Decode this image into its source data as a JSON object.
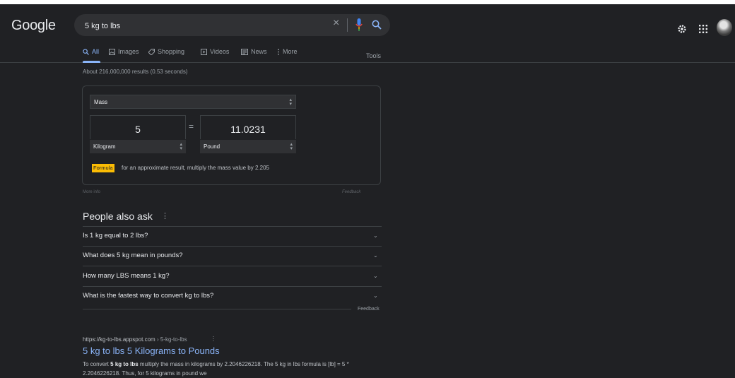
{
  "header": {
    "logo": "Google",
    "search_value": "5 kg to lbs",
    "icons": [
      "close-icon",
      "mic-icon",
      "search-icon",
      "gear-icon",
      "apps-icon",
      "avatar"
    ]
  },
  "tabs": [
    {
      "label": "All",
      "icon": "search-icon",
      "active": true
    },
    {
      "label": "Images",
      "icon": "image-icon"
    },
    {
      "label": "Shopping",
      "icon": "tag-icon"
    },
    {
      "label": "Videos",
      "icon": "play-icon"
    },
    {
      "label": "News",
      "icon": "newspaper-icon"
    },
    {
      "label": "More",
      "icon": "more-vert-icon"
    }
  ],
  "tools_label": "Tools",
  "stats": "About 216,000,000 results (0.53 seconds)",
  "converter": {
    "category": "Mass",
    "from_value": "5",
    "to_value": "11.0231",
    "from_unit": "Kilogram",
    "to_unit": "Pound",
    "formula_label": "Formula",
    "formula_text": "for an approximate result, multiply the mass value by 2.205",
    "more_info": "More info",
    "feedback": "Feedback"
  },
  "paa": {
    "title": "People also ask",
    "questions": [
      "Is 1 kg equal to 2 lbs?",
      "What does 5 kg mean in pounds?",
      "How many LBS means 1 kg?",
      "What is the fastest way to convert kg to lbs?"
    ],
    "feedback": "Feedback"
  },
  "result": {
    "domain": "https://kg-to-lbs.appspot.com",
    "path": " › 5-kg-to-lbs",
    "title": "5 kg to lbs 5 Kilograms to Pounds",
    "snippet_pre": "To convert ",
    "snippet_bold": "5 kg to lbs",
    "snippet_post": " multiply the mass in kilograms by 2.2046226218. The 5 kg in lbs formula is [lb] = 5 * 2.2046226218. Thus, for 5 kilograms in pound we"
  },
  "colors": {
    "background": "#202124",
    "link": "#8ab4f8",
    "formula_badge": "#fbbc04"
  }
}
